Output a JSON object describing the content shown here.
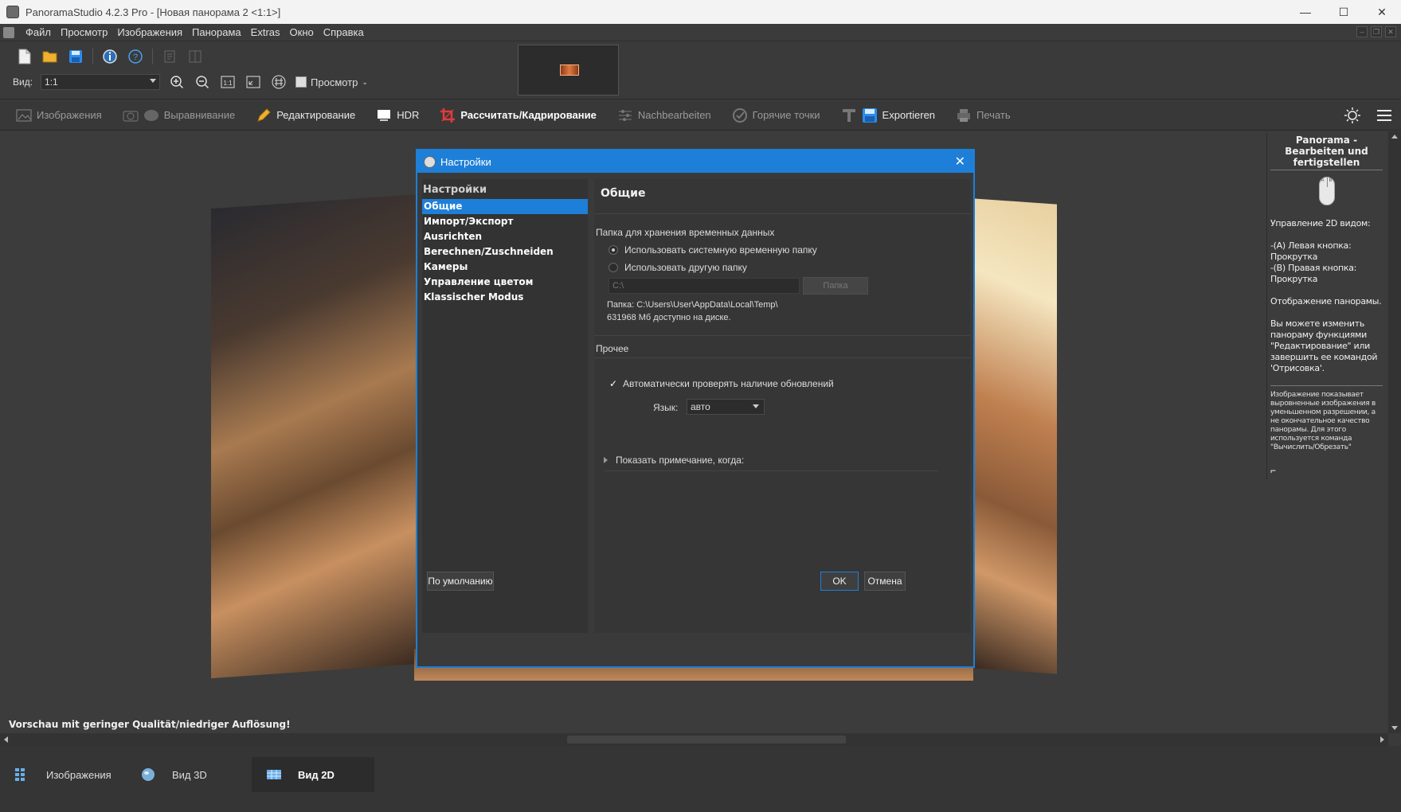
{
  "window": {
    "title": "PanoramaStudio 4.2.3 Pro - [Новая панорама 2 <1:1>]",
    "minimize": "—",
    "maximize": "☐",
    "close": "✕"
  },
  "menu": [
    "Файл",
    "Просмотр",
    "Изображения",
    "Панорама",
    "Extras",
    "Окно",
    "Справка"
  ],
  "toolbar": {
    "view_label": "Вид:",
    "view_value": "1:1",
    "preview_label": "Просмотр"
  },
  "workflow": [
    {
      "label": "Изображения",
      "state": "disabled"
    },
    {
      "label": "Выравнивание",
      "state": "disabled"
    },
    {
      "label": "Редактирование",
      "state": "enabled"
    },
    {
      "label": "HDR",
      "state": "enabled"
    },
    {
      "label": "Рассчитать/Кадрирование",
      "state": "active"
    },
    {
      "label": "Nachbearbeiten",
      "state": "disabled"
    },
    {
      "label": "Горячие точки",
      "state": "disabled"
    },
    {
      "label": "Exportieren",
      "state": "enabled"
    },
    {
      "label": "Печать",
      "state": "disabled"
    }
  ],
  "canvas": {
    "status_note": "Vorschau mit geringer Qualität/niedriger Auflösung!"
  },
  "sidepanel": {
    "title": "Panorama - Bearbeiten und fertigstellen",
    "text1": "Управление 2D видом:",
    "text2": "-(A) Левая кнопка: Прокрутка\n-(B) Правая кнопка: Прокрутка",
    "text3": "Отображение панорамы.",
    "text4": "Вы можете изменить панораму функциями \"Редактирование\" или завершить ее командой 'Отрисовка'.",
    "small": "Изображение показывает выровненные изображения в уменьшенном разрешении, а не окончательное качество панорамы. Для этого используется команда \"Вычислить/Обрезать\"",
    "mouse_a": "A",
    "mouse_b": "B"
  },
  "bottom_tabs": [
    {
      "label": "Изображения",
      "active": false
    },
    {
      "label": "Вид 3D",
      "active": false
    },
    {
      "label": "Вид 2D",
      "active": true
    }
  ],
  "dialog": {
    "title": "Настройки",
    "nav_head": "Настройки",
    "nav": [
      "Общие",
      "Импорт/Экспорт",
      "Ausrichten",
      "Berechnen/Zuschneiden",
      "Камеры",
      "Управление цветом",
      "Klassischer Modus"
    ],
    "content_head": "Общие",
    "temp_folder_label": "Папка для хранения временных данных",
    "radio_system": "Использовать системную временную папку",
    "radio_other": "Использовать другую папку",
    "path_value": "C:\\",
    "folder_button": "Папка",
    "folder_info": "Папка: C:\\Users\\User\\AppData\\Local\\Temp\\",
    "disk_info": "631968 Мб доступно на диске.",
    "misc_label": "Прочее",
    "check_updates": "Автоматически проверять наличие обновлений",
    "check_mark": "✓",
    "lang_label": "Язык:",
    "lang_value": "авто",
    "show_note": "Показать примечание, когда:",
    "default_button": "По умолчанию",
    "ok_button": "OK",
    "cancel_button": "Отмена"
  },
  "colors": {
    "accent": "#1e7fd8",
    "background": "#3a3a3a",
    "crop_icon": "#e23a3a",
    "export_icon": "#2b8cf0"
  }
}
